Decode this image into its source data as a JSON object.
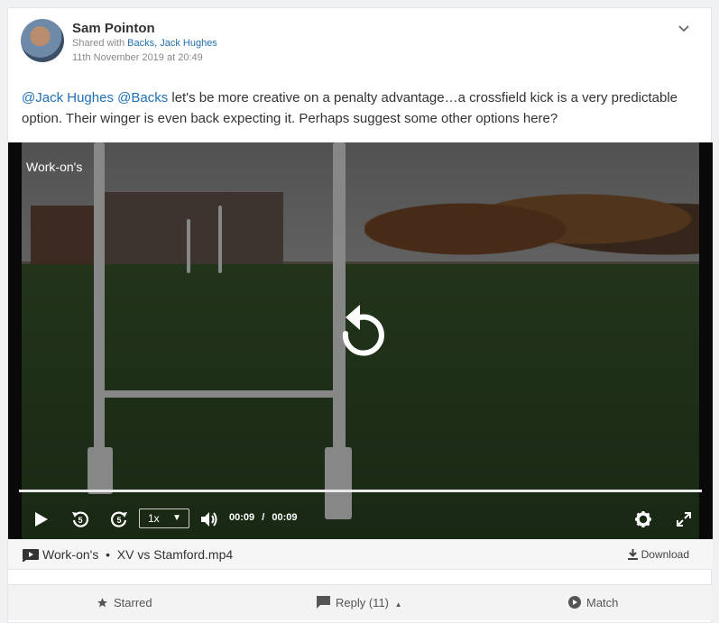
{
  "post": {
    "author": "Sam Pointon",
    "shared_prefix": "Shared with",
    "shared_with": "Backs, Jack Hughes",
    "date": "11th November 2019 at 20:49",
    "mention1": "@Jack Hughes",
    "mention2": "@Backs",
    "body": " let's be more creative on a penalty advantage…a crossfield kick is a very predictable option. Their winger is even back expecting it. Perhaps suggest some other options here?"
  },
  "video": {
    "overlay_label": "Work-on's",
    "speed": "1x",
    "current_time": "00:09",
    "separator": "/",
    "duration": "00:09",
    "progress_fraction": 1.0
  },
  "attachment": {
    "title": "Work-on's  •  XV vs Stamford.mp4",
    "download_label": "Download"
  },
  "actions": {
    "starred": "Starred",
    "reply": "Reply (11)",
    "match": "Match"
  },
  "colors": {
    "link": "#1f6fb5",
    "text": "#333333"
  }
}
